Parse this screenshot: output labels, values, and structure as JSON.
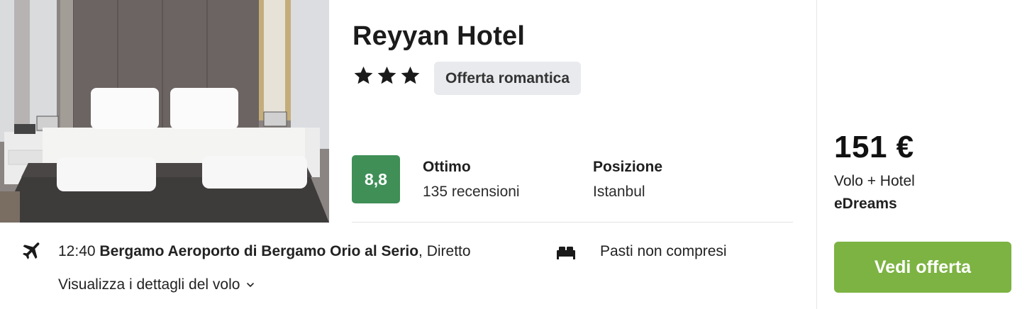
{
  "hotel": {
    "name": "Reyyan Hotel",
    "stars": 3,
    "tag": "Offerta romantica",
    "score": "8,8",
    "rating_label": "Ottimo",
    "reviews": "135 recensioni",
    "location_label": "Posizione",
    "location": "Istanbul"
  },
  "flight": {
    "time": "12:40",
    "airport": "Bergamo Aeroporto di Bergamo Orio al Serio",
    "type": ", Diretto",
    "details_link": "Visualizza i dettagli del volo"
  },
  "meals": "Pasti non compresi",
  "offer": {
    "price": "151 €",
    "package": "Volo + Hotel",
    "provider": "eDreams",
    "cta": "Vedi offerta"
  },
  "colors": {
    "score_bg": "#3f8f57",
    "cta_bg": "#7cb342",
    "tag_bg": "#e8eaee"
  },
  "icons": [
    "plane-icon",
    "bed-icon",
    "chevron-down-icon",
    "star-icon"
  ]
}
